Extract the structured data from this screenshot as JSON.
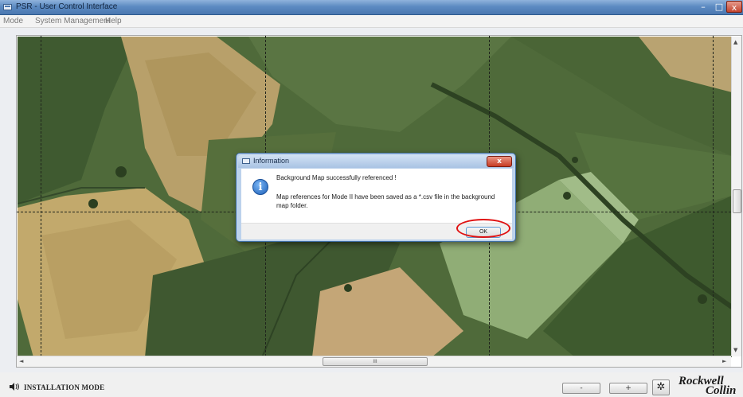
{
  "window": {
    "title": "PSR - User Control Interface",
    "controls": {
      "minimize": "–",
      "maximize": "□",
      "close": "x"
    }
  },
  "menu": {
    "items": [
      "Mode",
      "System Management",
      "Help"
    ]
  },
  "map": {
    "scrollbar": {
      "up": "▲",
      "down": "▼",
      "left": "◄",
      "right": "►",
      "grip": "III"
    }
  },
  "dialog": {
    "title": "Information",
    "close_label": "x",
    "icon": "info-icon",
    "icon_glyph": "i",
    "message_line1": "Background Map successfully referenced !",
    "message_line2": "Map references for Mode II have been saved as a *.csv file in the background map folder.",
    "ok_label": "OK",
    "highlight_color": "#e01010"
  },
  "statusbar": {
    "mode_label": "INSTALLATION MODE",
    "zoom_out_label": "-",
    "zoom_in_label": "+",
    "settings_icon": "gear-icon",
    "settings_glyph": "✲",
    "logo_line1": "Rockwell",
    "logo_line2": "Collin"
  }
}
